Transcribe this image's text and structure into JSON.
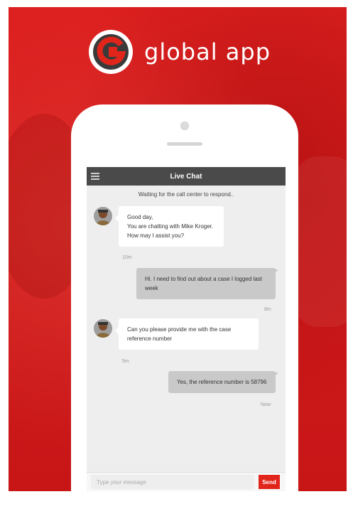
{
  "brand": {
    "name": "global app",
    "logo_letter": "G",
    "accent_color": "#e1251b"
  },
  "chat": {
    "title": "Live Chat",
    "status": "Waiting for the call center to respond..",
    "messages": [
      {
        "direction": "incoming",
        "lines": [
          "Good day,",
          "You are chatting with Mike Kroger.",
          "How may I assist you?"
        ],
        "time": "10m"
      },
      {
        "direction": "outgoing",
        "lines": [
          "Hi. I need to find out about a case I logged last",
          "week"
        ],
        "time": "8m"
      },
      {
        "direction": "incoming",
        "lines": [
          "Can you please provide me with the case",
          "reference number"
        ],
        "time": "5m"
      },
      {
        "direction": "outgoing",
        "lines": [
          "Yes, the reference number is 58796"
        ],
        "time": "Now"
      }
    ]
  },
  "composer": {
    "placeholder": "Type your message",
    "value": "",
    "send_label": "Send"
  },
  "icons": {
    "menu": "hamburger-menu-icon",
    "avatar": "agent-avatar-icon",
    "logo": "global-app-logo-icon"
  }
}
